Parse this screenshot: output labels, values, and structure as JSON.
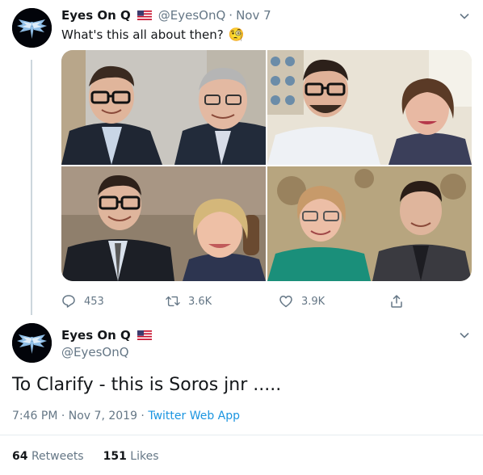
{
  "tweet1": {
    "display_name": "Eyes On Q",
    "handle": "@EyesOnQ",
    "separator": "·",
    "date": "Nov 7",
    "text": "What's this all about then?",
    "emoji": "🧐",
    "actions": {
      "reply_count": "453",
      "retweet_count": "3.6K",
      "like_count": "3.9K"
    }
  },
  "tweet2": {
    "display_name": "Eyes On Q",
    "handle": "@EyesOnQ",
    "text": "To Clarify - this is Soros jnr .....",
    "timestamp": "7:46 PM · Nov 7, 2019 · ",
    "source": "Twitter Web App",
    "stats": {
      "retweets_count": "64",
      "retweets_label": "Retweets",
      "likes_count": "151",
      "likes_label": "Likes"
    }
  },
  "icons": {
    "avatar": "angel-logo-icon",
    "flag": "us-flag-icon",
    "menu": "chevron-down-icon",
    "reply": "reply-icon",
    "retweet": "retweet-icon",
    "like": "heart-icon",
    "share": "share-icon"
  },
  "colors": {
    "accent": "#1b95e0",
    "secondary_text": "#657786",
    "divider": "#e6ecf0"
  }
}
